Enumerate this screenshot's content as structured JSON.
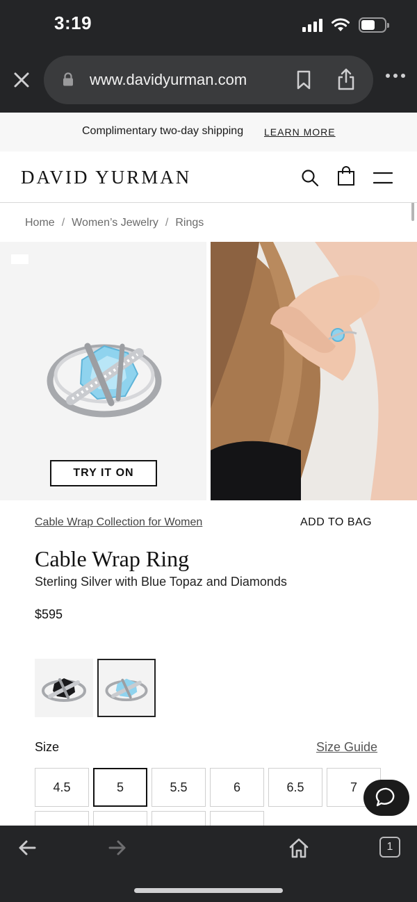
{
  "status_bar": {
    "time": "3:19"
  },
  "browser": {
    "url": "www.davidyurman.com",
    "tab_count": "1"
  },
  "promo": {
    "text": "Complimentary two-day shipping",
    "link": "LEARN MORE"
  },
  "header": {
    "logo": "DAVID YURMAN"
  },
  "breadcrumb": {
    "items": [
      "Home",
      "Women’s Jewelry",
      "Rings"
    ],
    "separator": "/"
  },
  "gallery": {
    "try_on_label": "TRY IT ON"
  },
  "product": {
    "collection_link": "Cable Wrap Collection for Women",
    "add_to_bag": "ADD TO BAG",
    "title": "Cable Wrap Ring",
    "subtitle": "Sterling Silver with Blue Topaz and Diamonds",
    "price": "$595",
    "selected_swatch": 2
  },
  "size": {
    "label": "Size",
    "guide_link": "Size Guide",
    "options": [
      "4.5",
      "5",
      "5.5",
      "6",
      "6.5",
      "7"
    ],
    "selected": "5"
  },
  "colors": {
    "chrome_bg": "#242527",
    "topaz": "#8fd3ee"
  }
}
